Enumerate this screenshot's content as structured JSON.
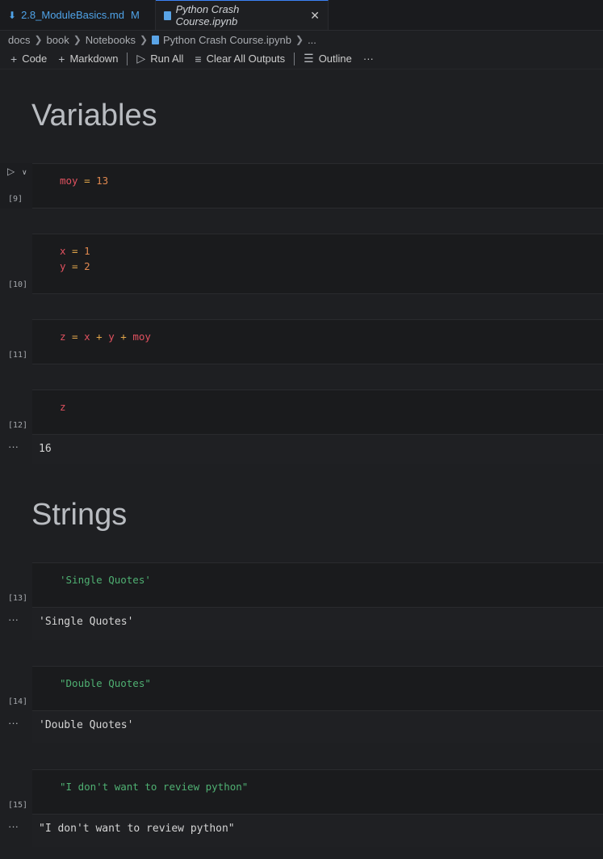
{
  "tabs": [
    {
      "name": "2.8_ModuleBasics.md",
      "modified": "M"
    },
    {
      "name": "Python Crash Course.ipynb",
      "close": "✕"
    }
  ],
  "breadcrumb": [
    "docs",
    "book",
    "Notebooks",
    "Python Crash Course.ipynb",
    "..."
  ],
  "toolbar": {
    "code": "Code",
    "markdown": "Markdown",
    "run_all": "Run All",
    "clear_outputs": "Clear All Outputs",
    "outline": "Outline",
    "more": "···"
  },
  "headings": {
    "variables": "Variables",
    "strings": "Strings"
  },
  "cells": {
    "c9": {
      "exec": "[9]",
      "var": "moy",
      "eq": " = ",
      "num": "13"
    },
    "c10": {
      "exec": "[10]",
      "l1v": "x",
      "l1eq": " = ",
      "l1n": "1",
      "l2v": "y",
      "l2eq": " = ",
      "l2n": "2"
    },
    "c11": {
      "exec": "[11]",
      "a": "z",
      "eq": " = ",
      "b": "x",
      "p1": " + ",
      "c": "y",
      "p2": " + ",
      "d": "moy"
    },
    "c12": {
      "exec": "[12]",
      "var": "z",
      "output": "16"
    },
    "c13": {
      "exec": "[13]",
      "str": "'Single Quotes'",
      "output": "'Single Quotes'"
    },
    "c14": {
      "exec": "[14]",
      "str": "\"Double Quotes\"",
      "output": "'Double Quotes'"
    },
    "c15": {
      "exec": "[15]",
      "str": "\"I don't want to review python\"",
      "output": "\"I don't want to review python\""
    }
  },
  "output_dots": "···"
}
